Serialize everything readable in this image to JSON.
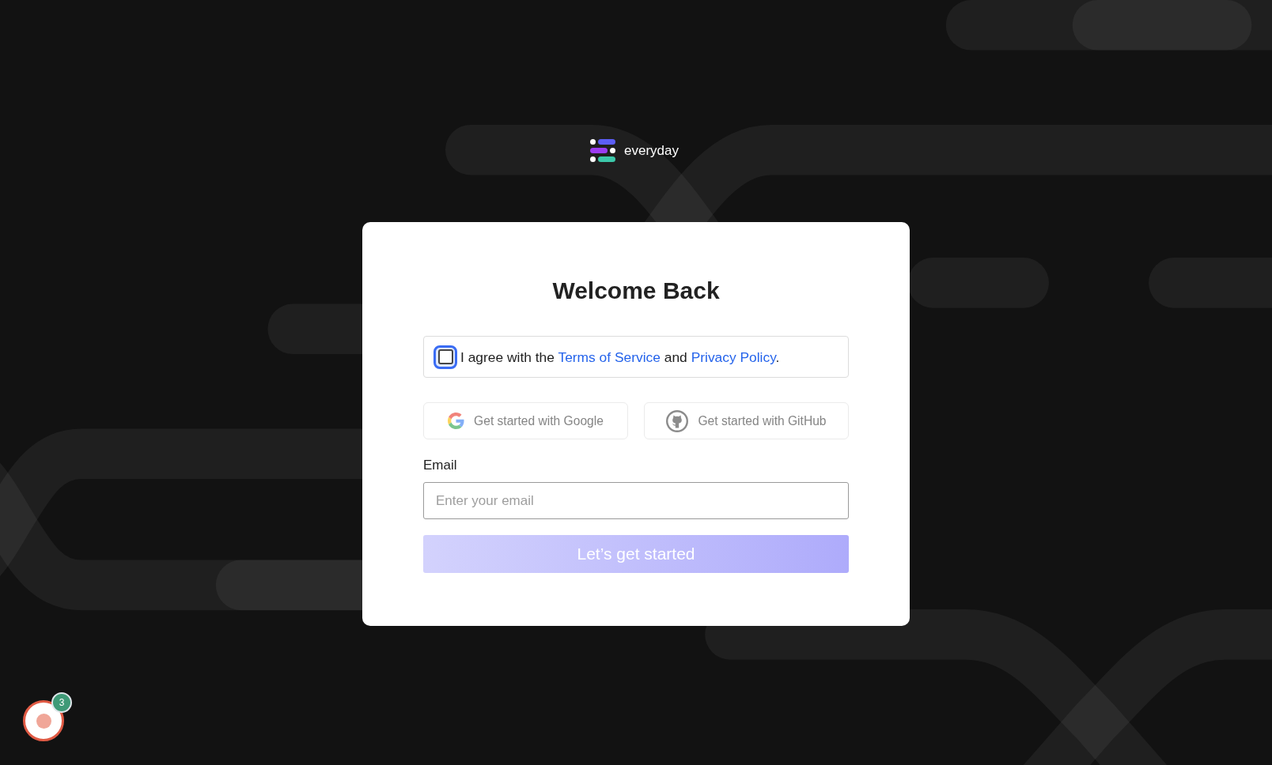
{
  "logo": {
    "name": "everyday"
  },
  "card": {
    "title": "Welcome Back",
    "consent": {
      "checked": false,
      "focused": true,
      "parts": [
        {
          "kind": "text",
          "text": "I agree with the "
        },
        {
          "kind": "link",
          "text": "Terms of Service"
        },
        {
          "kind": "text",
          "text": " and "
        },
        {
          "kind": "link",
          "text": "Privacy Policy"
        },
        {
          "kind": "text",
          "text": "."
        }
      ]
    },
    "social_buttons": [
      {
        "kind": "google",
        "label": "Get started with Google",
        "disabled": true
      },
      {
        "kind": "github",
        "label": "Get started with GitHub",
        "disabled": true
      }
    ],
    "email": {
      "label": "Email",
      "placeholder": "Enter your email"
    },
    "submit": {
      "label": "Let’s get started",
      "disabled": true
    }
  },
  "widget": {
    "badge": "3"
  }
}
